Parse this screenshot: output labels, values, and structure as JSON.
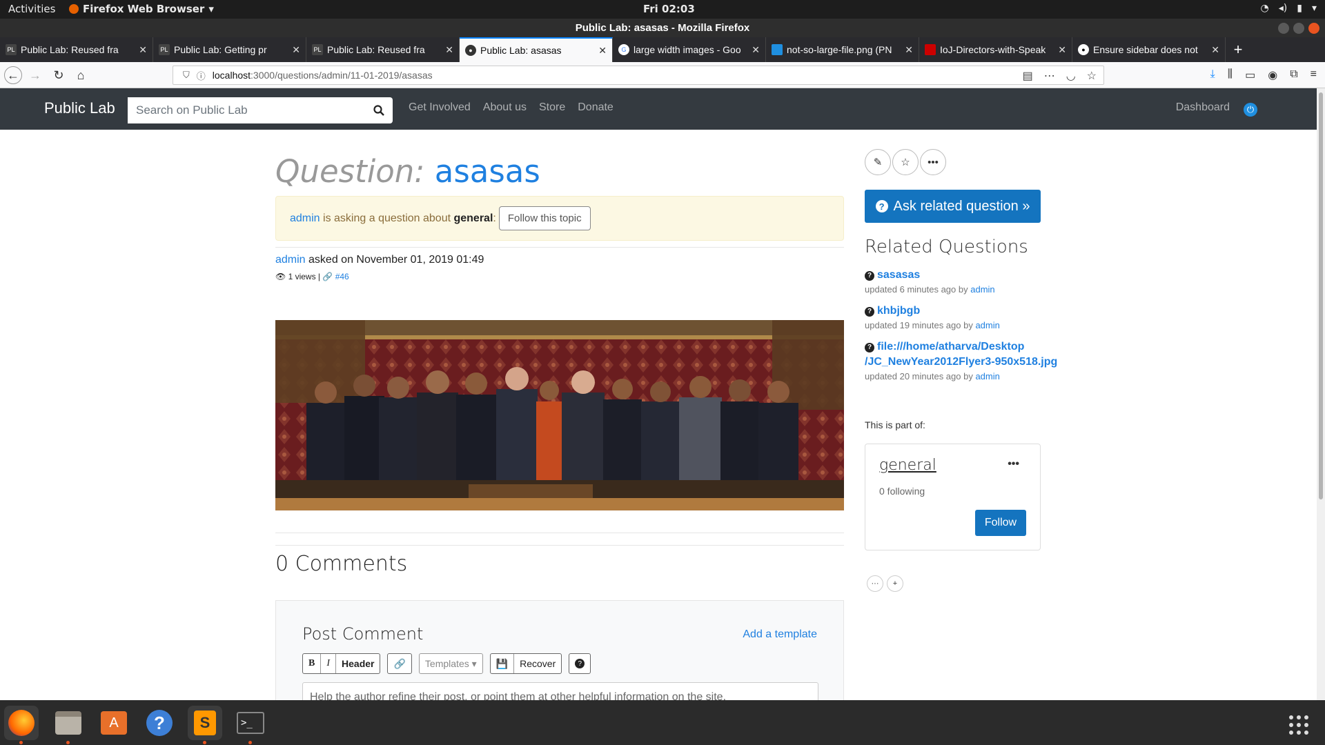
{
  "system": {
    "activities": "Activities",
    "app_name": "Firefox Web Browser",
    "clock": "Fri 02:03"
  },
  "window": {
    "title": "Public Lab: asasas - Mozilla Firefox"
  },
  "tabs": [
    {
      "title": "Public Lab: Reused fra",
      "active": false
    },
    {
      "title": "Public Lab: Getting pr",
      "active": false
    },
    {
      "title": "Public Lab: Reused fra",
      "active": false
    },
    {
      "title": "Public Lab: asasas",
      "active": true
    },
    {
      "title": "large width images - Goo",
      "active": false
    },
    {
      "title": "not-so-large-file.png (PN",
      "active": false
    },
    {
      "title": "IoJ-Directors-with-Speak",
      "active": false
    },
    {
      "title": "Ensure sidebar does not",
      "active": false
    }
  ],
  "url": {
    "host": "localhost",
    "path": ":3000/questions/admin/11-01-2019/asasas"
  },
  "site": {
    "brand": "Public Lab",
    "search_placeholder": "Search on Public Lab",
    "nav": [
      "Get Involved",
      "About us",
      "Store",
      "Donate"
    ],
    "dashboard": "Dashboard"
  },
  "question": {
    "prefix": "Question:",
    "title": "asasas",
    "alert_user": "admin",
    "alert_text": " is asking a question about ",
    "alert_topic": "general",
    "alert_colon": ":",
    "follow_topic": "Follow this topic",
    "author": "admin",
    "asked_text": " asked on November 01, 2019 01:49",
    "views": "1 views",
    "sep": " | ",
    "node": "#46"
  },
  "comments": {
    "title": "0 Comments",
    "post_title": "Post Comment",
    "add_template": "Add a template",
    "bold": "B",
    "italic": "I",
    "header": "Header",
    "templates": "Templates",
    "recover": "Recover",
    "placeholder": "Help the author refine their post, or point them at other helpful information on the site."
  },
  "sidebar": {
    "ask_related": "Ask related question »",
    "related_title": "Related Questions",
    "related": [
      {
        "title": "sasasas",
        "updated": "updated 6 minutes ago by ",
        "user": "admin"
      },
      {
        "title": "khbjbgb",
        "updated": "updated 19 minutes ago by ",
        "user": "admin"
      },
      {
        "title": "file:///home/atharva/Desktop/JC_NewYear2012Flyer3-950x518.jpg",
        "title_line1": "file:///home/atharva/Desktop",
        "title_line2": "/JC_NewYear2012Flyer3-950x518.jpg",
        "updated": "updated 20 minutes ago by ",
        "user": "admin"
      }
    ],
    "part_of": "This is part of:",
    "tag": {
      "name": "general",
      "following": "0 following",
      "follow": "Follow"
    }
  },
  "colors": {
    "link": "#1f80e0",
    "primary_button": "#1474bf",
    "navbar": "#343a40",
    "alert_bg": "#fcf8e3"
  }
}
